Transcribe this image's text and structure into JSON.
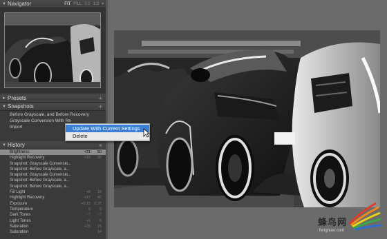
{
  "navigator": {
    "title": "Navigator",
    "zoom_options": [
      "FIT",
      "FILL",
      "1:1",
      "1:3"
    ]
  },
  "presets": {
    "title": "Presets"
  },
  "snapshots": {
    "title": "Snapshots",
    "items": [
      "Before Grayscale, and Before Recovery",
      "Grayscale Conversion With Re",
      "Import"
    ]
  },
  "history": {
    "title": "History",
    "items": [
      {
        "label": "Brightness",
        "v1": "+21",
        "v2": "50"
      },
      {
        "label": "Highlight Recovery",
        "v1": "+10",
        "v2": "39"
      },
      {
        "label": "Snapshot: Grayscale Conversio...",
        "v1": "",
        "v2": ""
      },
      {
        "label": "Snapshot: Before Grayscale, a...",
        "v1": "",
        "v2": ""
      },
      {
        "label": "Snapshot: Grayscale Conversio...",
        "v1": "",
        "v2": ""
      },
      {
        "label": "Snapshot: Before Grayscale, a...",
        "v1": "",
        "v2": ""
      },
      {
        "label": "Snapshot: Before Grayscale, a...",
        "v1": "",
        "v2": ""
      },
      {
        "label": "Fill Light",
        "v1": "+8",
        "v2": "18"
      },
      {
        "label": "Highlight Recovery",
        "v1": "+17",
        "v2": "42"
      },
      {
        "label": "Exposure",
        "v1": "+0.15",
        "v2": "0.37"
      },
      {
        "label": "Temperature",
        "v1": "0",
        "v2": "0"
      },
      {
        "label": "Dark Tones",
        "v1": "-7",
        "v2": "-7"
      },
      {
        "label": "Light Tones",
        "v1": "+1",
        "v2": "5"
      },
      {
        "label": "Saturation",
        "v1": "+15",
        "v2": "15"
      },
      {
        "label": "Saturation",
        "v1": "",
        "v2": "14"
      }
    ]
  },
  "context_menu": {
    "items": [
      "Update With Current Settings",
      "Delete"
    ]
  },
  "watermark": {
    "chinese": "蜂鸟网",
    "url": "fengniao.com"
  },
  "colors": {
    "panel_bg": "#3a3a3a",
    "workspace_bg": "#6b6b6b",
    "menu_highlight": "#3d7fd6",
    "history_selected": "#8d8d8d"
  }
}
